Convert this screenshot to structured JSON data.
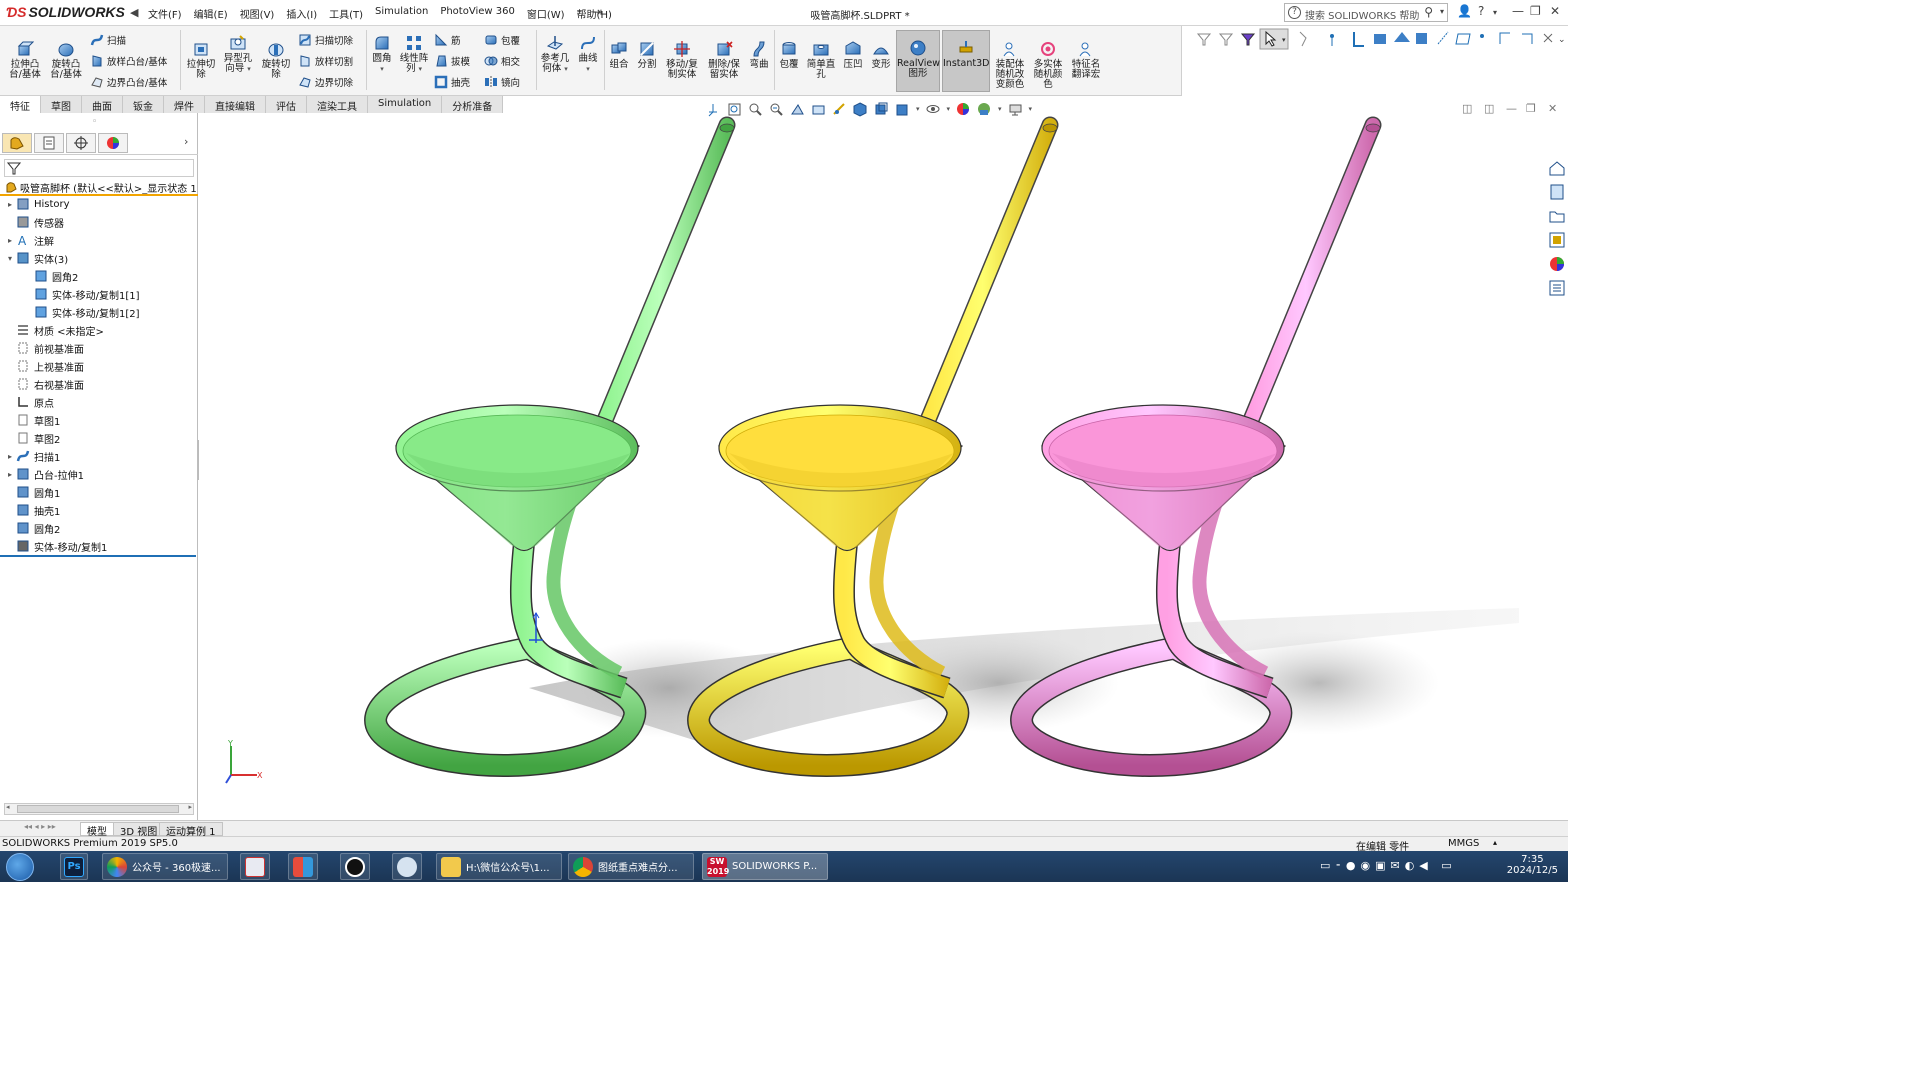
{
  "window": {
    "brand": "SOLIDWORKS",
    "doc_title": "吸管高脚杯.SLDPRT *",
    "menu": [
      "文件(F)",
      "编辑(E)",
      "视图(V)",
      "插入(I)",
      "工具(T)",
      "Simulation",
      "PhotoView 360",
      "窗口(W)",
      "帮助(H)"
    ],
    "search_placeholder": "搜索 SOLIDWORKS 帮助"
  },
  "commands": {
    "extrude_boss": "拉伸凸\n台/基体",
    "revolve_boss": "旋转凸\n台/基体",
    "sweep": "扫描",
    "loft_boss": "放样凸台/基体",
    "boundary_boss": "边界凸台/基体",
    "extrude_cut": "拉伸切\n除",
    "hole_wizard": "异型孔\n向导",
    "revolve_cut": "旋转切\n除",
    "sweep_cut": "扫描切除",
    "loft_cut": "放样切割",
    "boundary_cut": "边界切除",
    "fillet": "圆角",
    "linear_pattern": "线性阵\n列",
    "rib": "筋",
    "draft": "拔模",
    "shell": "抽壳",
    "wrap": "包覆",
    "intersect": "相交",
    "mirror": "镜向",
    "ref_geometry": "参考几\n何体",
    "curves": "曲线",
    "combine": "组合",
    "split": "分割",
    "move_copy": "移动/复\n制实体",
    "delete_keep": "删除/保\n留实体",
    "flex": "弯曲",
    "wrap2": "包覆",
    "simple_hole": "简单直\n孔",
    "indent": "压凹",
    "deform": "变形",
    "realview": "RealView\n图形",
    "instant3d": "Instant3D",
    "assembly_color": "装配体\n随机改\n变颜色",
    "multibody_color": "多实体\n随机颜\n色",
    "feature_rename": "特征名\n翻译宏"
  },
  "tabs": [
    "特征",
    "草图",
    "曲面",
    "钣金",
    "焊件",
    "直接编辑",
    "评估",
    "渲染工具",
    "Simulation",
    "分析准备"
  ],
  "tree": {
    "root": "吸管高脚杯 (默认<<默认>_显示状态 1",
    "items": [
      {
        "label": "History",
        "level": 0,
        "twisty": "▸",
        "icon": "history-icon"
      },
      {
        "label": "传感器",
        "level": 0,
        "twisty": "",
        "icon": "sensor-icon"
      },
      {
        "label": "注解",
        "level": 0,
        "twisty": "▸",
        "icon": "annotation-icon"
      },
      {
        "label": "实体(3)",
        "level": 0,
        "twisty": "▾",
        "icon": "solid-bodies-icon"
      },
      {
        "label": "圆角2",
        "level": 1,
        "twisty": "",
        "icon": "body-icon"
      },
      {
        "label": "实体-移动/复制1[1]",
        "level": 1,
        "twisty": "",
        "icon": "body-icon"
      },
      {
        "label": "实体-移动/复制1[2]",
        "level": 1,
        "twisty": "",
        "icon": "body-icon"
      },
      {
        "label": "材质 <未指定>",
        "level": 0,
        "twisty": "",
        "icon": "material-icon"
      },
      {
        "label": "前视基准面",
        "level": 0,
        "twisty": "",
        "icon": "plane-icon"
      },
      {
        "label": "上视基准面",
        "level": 0,
        "twisty": "",
        "icon": "plane-icon"
      },
      {
        "label": "右视基准面",
        "level": 0,
        "twisty": "",
        "icon": "plane-icon"
      },
      {
        "label": "原点",
        "level": 0,
        "twisty": "",
        "icon": "origin-icon"
      },
      {
        "label": "草图1",
        "level": 0,
        "twisty": "",
        "icon": "sketch-icon"
      },
      {
        "label": "草图2",
        "level": 0,
        "twisty": "",
        "icon": "sketch-icon"
      },
      {
        "label": "扫描1",
        "level": 0,
        "twisty": "▸",
        "icon": "sweep-icon"
      },
      {
        "label": "凸台-拉伸1",
        "level": 0,
        "twisty": "▸",
        "icon": "extrude-icon"
      },
      {
        "label": "圆角1",
        "level": 0,
        "twisty": "",
        "icon": "fillet-icon"
      },
      {
        "label": "抽壳1",
        "level": 0,
        "twisty": "",
        "icon": "shell-icon"
      },
      {
        "label": "圆角2",
        "level": 0,
        "twisty": "",
        "icon": "fillet-icon"
      },
      {
        "label": "实体-移动/复制1",
        "level": 0,
        "twisty": "",
        "icon": "move-copy-icon"
      }
    ]
  },
  "bottom_tabs": [
    "模型",
    "3D 视图",
    "运动算例 1"
  ],
  "status": {
    "product": "SOLIDWORKS Premium 2019 SP5.0",
    "mode": "在编辑 零件",
    "units": "MMGS"
  },
  "taskbar": {
    "items": [
      "公众号 - 360极速...",
      "H:\\微信公众号\\1...",
      "图纸重点难点分...",
      "SOLIDWORKS P..."
    ],
    "sw_year": "2019",
    "time": "7:35",
    "date": "2024/12/5"
  },
  "model": {
    "bodies": [
      {
        "name": "green cup",
        "color": "#7ee07e"
      },
      {
        "name": "yellow cup",
        "color": "#f7d433"
      },
      {
        "name": "pink cup",
        "color": "#f08ccf"
      }
    ]
  },
  "triad": {
    "y": "Y",
    "x": "X"
  }
}
